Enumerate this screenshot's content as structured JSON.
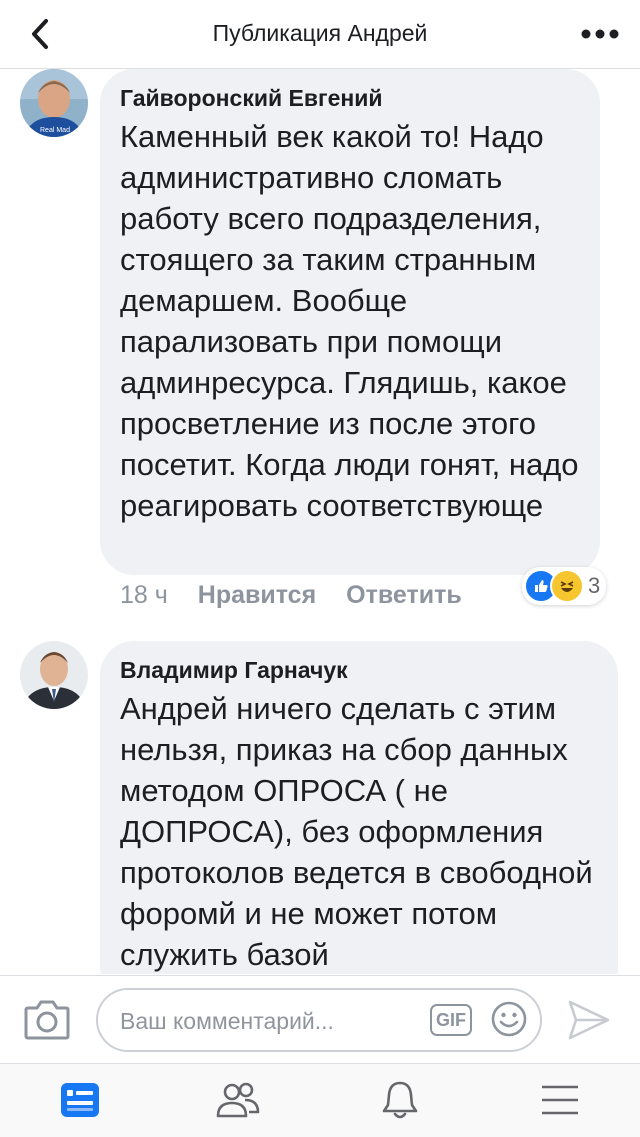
{
  "header": {
    "title": "Публикация Андрей",
    "back_icon": "chevron-left-icon",
    "more_icon": "more-dots-icon"
  },
  "comments": [
    {
      "author": "Гайворонский Евгений",
      "avatar_caption": "Real Mad",
      "text": "Каменный век какой то! Надо административно сломать работу всего подразделения, стоящего за таким странным демаршем. Вообще парализовать при помощи админресурса. Глядишь, какое просветление из после этого посетит. Когда люди гонят, надо реагировать соответствующе",
      "time": "18 ч",
      "like_label": "Нравится",
      "reply_label": "Ответить",
      "reactions": {
        "types": [
          "like",
          "haha"
        ],
        "count": "3"
      }
    },
    {
      "author": "Владимир Гарначук",
      "text": "Андрей ничего сделать с этим нельзя,  приказ на сбор данных методом ОПРОСА ( не ДОПРОСА), без оформления протоколов ведется в свободной форомй и не может потом служить  базой"
    }
  ],
  "composer": {
    "placeholder": "Ваш комментарий...",
    "gif_label": "GIF",
    "camera_icon": "camera-icon",
    "emoji_icon": "smiley-icon",
    "send_icon": "send-icon"
  },
  "tabbar": {
    "items": [
      "feed-icon",
      "friends-icon",
      "notifications-icon",
      "menu-icon"
    ],
    "active": "feed-icon"
  },
  "colors": {
    "accent": "#1877f2",
    "bubble": "#f0f1f4",
    "muted_text": "#8d949e",
    "tab_icon": "#65676b"
  }
}
